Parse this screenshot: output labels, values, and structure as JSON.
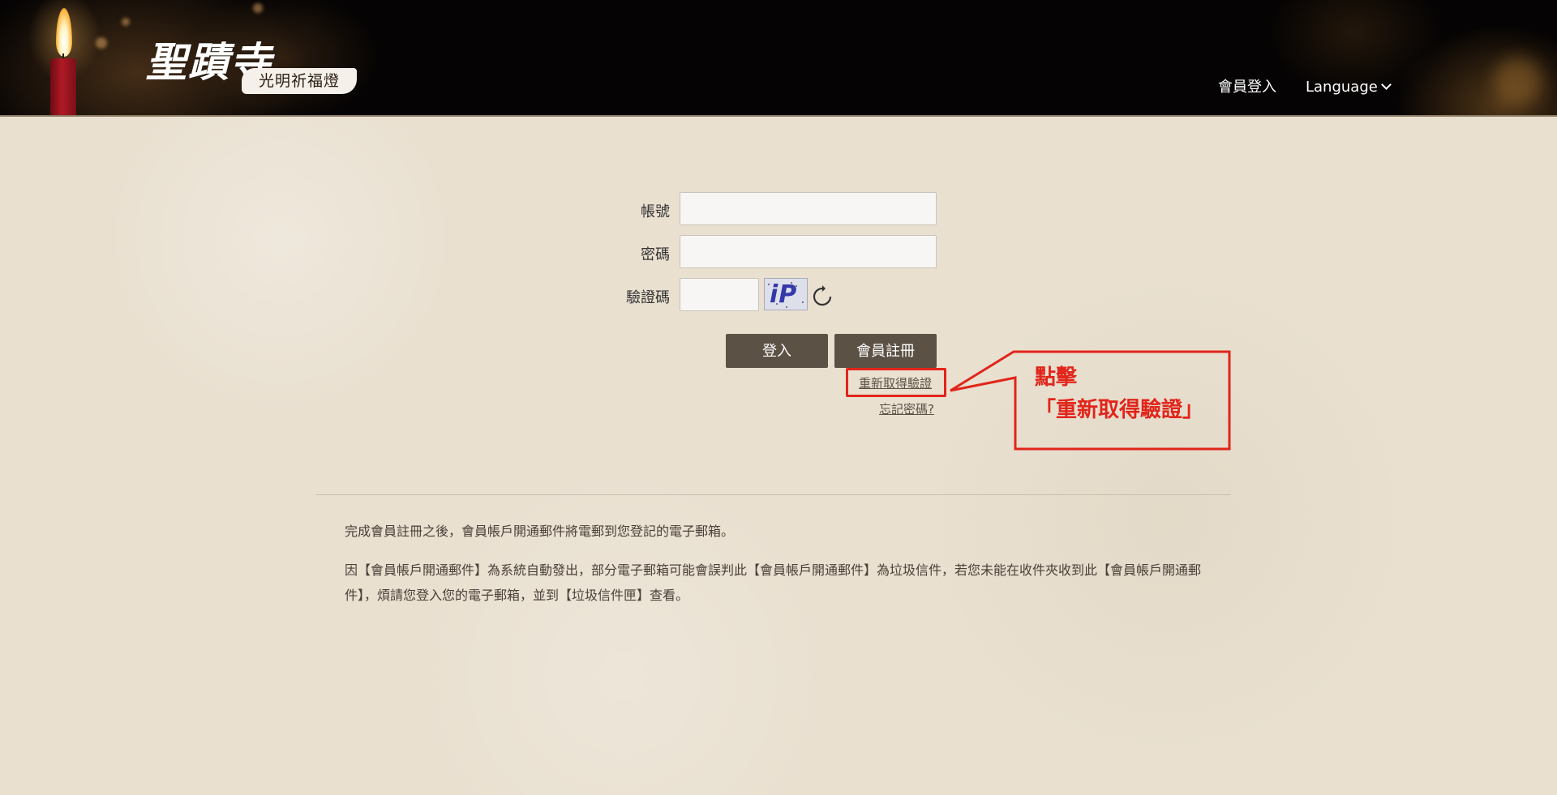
{
  "header": {
    "logo_main": "聖蹟寺",
    "logo_sub": "光明祈福燈",
    "nav_login": "會員登入",
    "nav_language": "Language"
  },
  "form": {
    "account_label": "帳號",
    "password_label": "密碼",
    "captcha_label": "驗證碼",
    "captcha_text": "iP",
    "account_value": "",
    "password_value": "",
    "captcha_value": "",
    "login_button": "登入",
    "register_button": "會員註冊",
    "resend_link": "重新取得驗證",
    "forgot_link": "忘記密碼?"
  },
  "callout": {
    "line1": "點擊",
    "line2": "「重新取得驗證」",
    "color": "#e1251b"
  },
  "notice": {
    "para1": "完成會員註冊之後，會員帳戶開通郵件將電郵到您登記的電子郵箱。",
    "para2": "因【會員帳戶開通郵件】為系統自動發出，部分電子郵箱可能會誤判此【會員帳戶開通郵件】為垃圾信件，若您未能在收件夾收到此【會員帳戶開通郵件】，煩請您登入您的電子郵箱，並到【垃圾信件匣】查看。"
  },
  "colors": {
    "header_bg": "#050303",
    "page_bg": "#e9e0d0",
    "button_bg": "#5c5145",
    "accent_red": "#e1251b"
  },
  "icons": {
    "refresh": "refresh-icon",
    "candle": "candle-icon",
    "chevron": "chevron-down-icon"
  }
}
